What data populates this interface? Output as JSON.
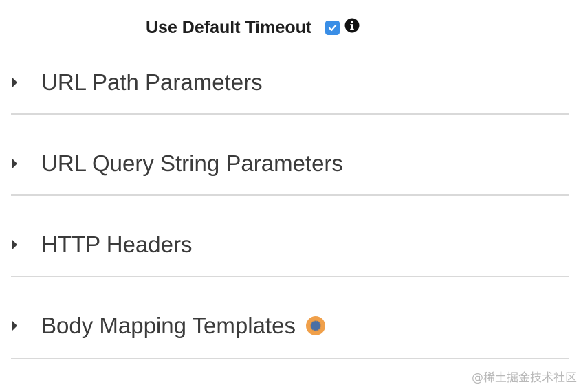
{
  "timeout": {
    "label": "Use Default Timeout",
    "checked": true,
    "checkbox_icon": "checkmark-icon",
    "info_icon": "info-icon"
  },
  "sections": [
    {
      "title": "URL Path Parameters",
      "icon": "caret-right-icon"
    },
    {
      "title": "URL Query String Parameters",
      "icon": "caret-right-icon"
    },
    {
      "title": "HTTP Headers",
      "icon": "caret-right-icon"
    },
    {
      "title": "Body Mapping Templates",
      "icon": "caret-right-icon",
      "status_icon": "loading-dot-icon"
    }
  ],
  "watermark": "@稀土掘金技术社区",
  "colors": {
    "checkbox": "#3a8ee6",
    "status_dot": "#f0a04a",
    "divider": "#d9d9d9",
    "text": "#3b3b3b"
  }
}
